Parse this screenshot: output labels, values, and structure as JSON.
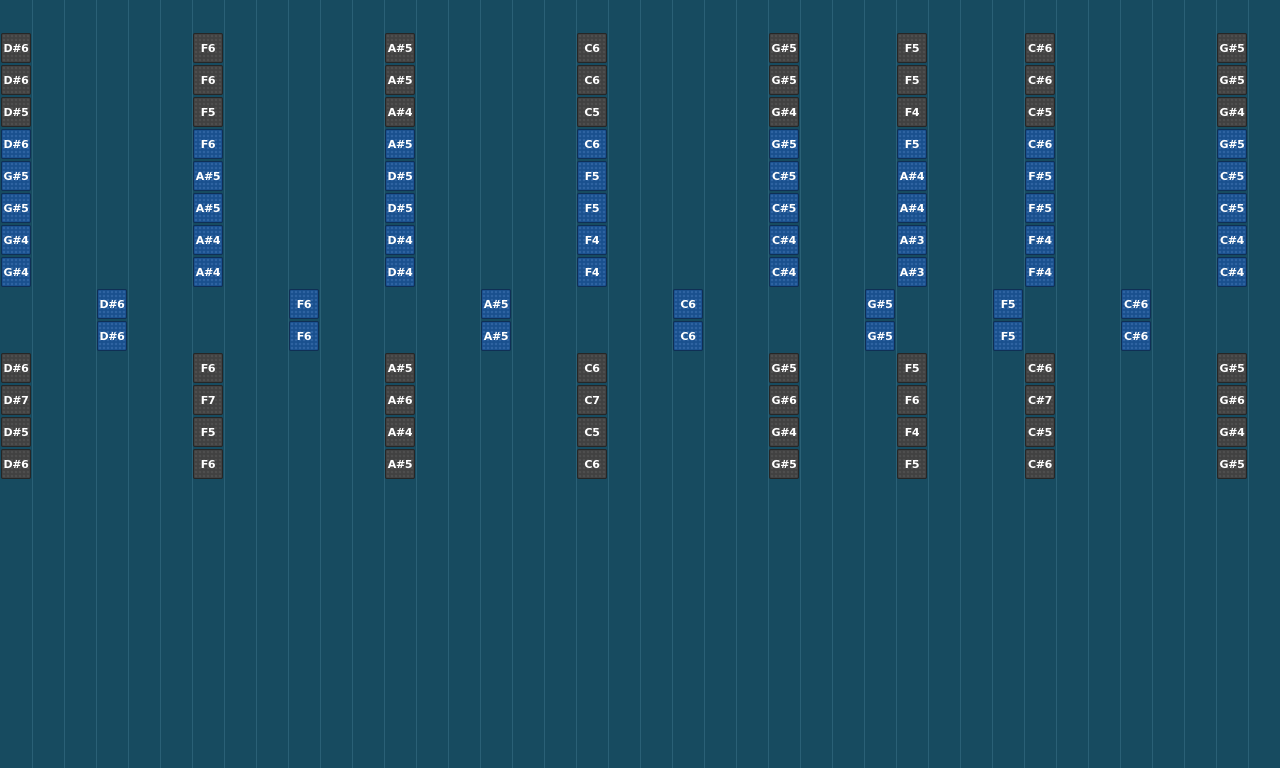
{
  "colors": {
    "background": "#174b60",
    "gridline": "#2a6076",
    "note_gray": "#414141",
    "note_blue": "#19508e"
  },
  "columns": [
    {
      "notes": [
        {
          "label": "D#6",
          "style": "gray"
        },
        {
          "label": "D#6",
          "style": "gray"
        },
        {
          "label": "D#5",
          "style": "gray"
        },
        {
          "label": "D#6",
          "style": "blue"
        },
        {
          "label": "G#5",
          "style": "blue"
        },
        {
          "label": "G#5",
          "style": "blue"
        },
        {
          "label": "G#4",
          "style": "blue"
        },
        {
          "label": "G#4",
          "style": "blue"
        },
        {
          "label": null
        },
        {
          "label": null
        },
        {
          "label": "D#6",
          "style": "gray"
        },
        {
          "label": "D#7",
          "style": "gray"
        },
        {
          "label": "D#5",
          "style": "gray"
        },
        {
          "label": "D#6",
          "style": "gray"
        }
      ]
    },
    {
      "notes": [
        {
          "label": null
        },
        {
          "label": null
        },
        {
          "label": null
        },
        {
          "label": null
        },
        {
          "label": null
        },
        {
          "label": null
        },
        {
          "label": null
        },
        {
          "label": null
        },
        {
          "label": "D#6",
          "style": "blue"
        },
        {
          "label": "D#6",
          "style": "blue"
        }
      ]
    },
    {
      "notes": [
        {
          "label": "F6",
          "style": "gray"
        },
        {
          "label": "F6",
          "style": "gray"
        },
        {
          "label": "F5",
          "style": "gray"
        },
        {
          "label": "F6",
          "style": "blue"
        },
        {
          "label": "A#5",
          "style": "blue"
        },
        {
          "label": "A#5",
          "style": "blue"
        },
        {
          "label": "A#4",
          "style": "blue"
        },
        {
          "label": "A#4",
          "style": "blue"
        },
        {
          "label": null
        },
        {
          "label": null
        },
        {
          "label": "F6",
          "style": "gray"
        },
        {
          "label": "F7",
          "style": "gray"
        },
        {
          "label": "F5",
          "style": "gray"
        },
        {
          "label": "F6",
          "style": "gray"
        }
      ]
    },
    {
      "notes": [
        {
          "label": null
        },
        {
          "label": null
        },
        {
          "label": null
        },
        {
          "label": null
        },
        {
          "label": null
        },
        {
          "label": null
        },
        {
          "label": null
        },
        {
          "label": null
        },
        {
          "label": "F6",
          "style": "blue"
        },
        {
          "label": "F6",
          "style": "blue"
        }
      ]
    },
    {
      "notes": [
        {
          "label": "A#5",
          "style": "gray"
        },
        {
          "label": "A#5",
          "style": "gray"
        },
        {
          "label": "A#4",
          "style": "gray"
        },
        {
          "label": "A#5",
          "style": "blue"
        },
        {
          "label": "D#5",
          "style": "blue"
        },
        {
          "label": "D#5",
          "style": "blue"
        },
        {
          "label": "D#4",
          "style": "blue"
        },
        {
          "label": "D#4",
          "style": "blue"
        },
        {
          "label": null
        },
        {
          "label": null
        },
        {
          "label": "A#5",
          "style": "gray"
        },
        {
          "label": "A#6",
          "style": "gray"
        },
        {
          "label": "A#4",
          "style": "gray"
        },
        {
          "label": "A#5",
          "style": "gray"
        }
      ]
    },
    {
      "notes": [
        {
          "label": null
        },
        {
          "label": null
        },
        {
          "label": null
        },
        {
          "label": null
        },
        {
          "label": null
        },
        {
          "label": null
        },
        {
          "label": null
        },
        {
          "label": null
        },
        {
          "label": "A#5",
          "style": "blue"
        },
        {
          "label": "A#5",
          "style": "blue"
        }
      ]
    },
    {
      "notes": [
        {
          "label": "C6",
          "style": "gray"
        },
        {
          "label": "C6",
          "style": "gray"
        },
        {
          "label": "C5",
          "style": "gray"
        },
        {
          "label": "C6",
          "style": "blue"
        },
        {
          "label": "F5",
          "style": "blue"
        },
        {
          "label": "F5",
          "style": "blue"
        },
        {
          "label": "F4",
          "style": "blue"
        },
        {
          "label": "F4",
          "style": "blue"
        },
        {
          "label": null
        },
        {
          "label": null
        },
        {
          "label": "C6",
          "style": "gray"
        },
        {
          "label": "C7",
          "style": "gray"
        },
        {
          "label": "C5",
          "style": "gray"
        },
        {
          "label": "C6",
          "style": "gray"
        }
      ]
    },
    {
      "notes": [
        {
          "label": null
        },
        {
          "label": null
        },
        {
          "label": null
        },
        {
          "label": null
        },
        {
          "label": null
        },
        {
          "label": null
        },
        {
          "label": null
        },
        {
          "label": null
        },
        {
          "label": "C6",
          "style": "blue"
        },
        {
          "label": "C6",
          "style": "blue"
        }
      ]
    },
    {
      "notes": [
        {
          "label": "G#5",
          "style": "gray"
        },
        {
          "label": "G#5",
          "style": "gray"
        },
        {
          "label": "G#4",
          "style": "gray"
        },
        {
          "label": "G#5",
          "style": "blue"
        },
        {
          "label": "C#5",
          "style": "blue"
        },
        {
          "label": "C#5",
          "style": "blue"
        },
        {
          "label": "C#4",
          "style": "blue"
        },
        {
          "label": "C#4",
          "style": "blue"
        },
        {
          "label": null
        },
        {
          "label": null
        },
        {
          "label": "G#5",
          "style": "gray"
        },
        {
          "label": "G#6",
          "style": "gray"
        },
        {
          "label": "G#4",
          "style": "gray"
        },
        {
          "label": "G#5",
          "style": "gray"
        }
      ]
    },
    {
      "notes": [
        {
          "label": null
        },
        {
          "label": null
        },
        {
          "label": null
        },
        {
          "label": null
        },
        {
          "label": null
        },
        {
          "label": null
        },
        {
          "label": null
        },
        {
          "label": null
        },
        {
          "label": "G#5",
          "style": "blue"
        },
        {
          "label": "G#5",
          "style": "blue"
        }
      ]
    },
    {
      "notes": [
        {
          "label": "F5",
          "style": "gray"
        },
        {
          "label": "F5",
          "style": "gray"
        },
        {
          "label": "F4",
          "style": "gray"
        },
        {
          "label": "F5",
          "style": "blue"
        },
        {
          "label": "A#4",
          "style": "blue"
        },
        {
          "label": "A#4",
          "style": "blue"
        },
        {
          "label": "A#3",
          "style": "blue"
        },
        {
          "label": "A#3",
          "style": "blue"
        },
        {
          "label": null
        },
        {
          "label": null
        },
        {
          "label": "F5",
          "style": "gray"
        },
        {
          "label": "F6",
          "style": "gray"
        },
        {
          "label": "F4",
          "style": "gray"
        },
        {
          "label": "F5",
          "style": "gray"
        }
      ]
    },
    {
      "notes": [
        {
          "label": null
        },
        {
          "label": null
        },
        {
          "label": null
        },
        {
          "label": null
        },
        {
          "label": null
        },
        {
          "label": null
        },
        {
          "label": null
        },
        {
          "label": null
        },
        {
          "label": "F5",
          "style": "blue"
        },
        {
          "label": "F5",
          "style": "blue"
        }
      ]
    },
    {
      "notes": [
        {
          "label": "C#6",
          "style": "gray"
        },
        {
          "label": "C#6",
          "style": "gray"
        },
        {
          "label": "C#5",
          "style": "gray"
        },
        {
          "label": "C#6",
          "style": "blue"
        },
        {
          "label": "F#5",
          "style": "blue"
        },
        {
          "label": "F#5",
          "style": "blue"
        },
        {
          "label": "F#4",
          "style": "blue"
        },
        {
          "label": "F#4",
          "style": "blue"
        },
        {
          "label": null
        },
        {
          "label": null
        },
        {
          "label": "C#6",
          "style": "gray"
        },
        {
          "label": "C#7",
          "style": "gray"
        },
        {
          "label": "C#5",
          "style": "gray"
        },
        {
          "label": "C#6",
          "style": "gray"
        }
      ]
    },
    {
      "notes": [
        {
          "label": null
        },
        {
          "label": null
        },
        {
          "label": null
        },
        {
          "label": null
        },
        {
          "label": null
        },
        {
          "label": null
        },
        {
          "label": null
        },
        {
          "label": null
        },
        {
          "label": "C#6",
          "style": "blue"
        },
        {
          "label": "C#6",
          "style": "blue"
        }
      ]
    },
    {
      "notes": [
        {
          "label": "G#5",
          "style": "gray"
        },
        {
          "label": "G#5",
          "style": "gray"
        },
        {
          "label": "G#4",
          "style": "gray"
        },
        {
          "label": "G#5",
          "style": "blue"
        },
        {
          "label": "C#5",
          "style": "blue"
        },
        {
          "label": "C#5",
          "style": "blue"
        },
        {
          "label": "C#4",
          "style": "blue"
        },
        {
          "label": "C#4",
          "style": "blue"
        },
        {
          "label": null
        },
        {
          "label": null
        },
        {
          "label": "G#5",
          "style": "gray"
        },
        {
          "label": "G#6",
          "style": "gray"
        },
        {
          "label": "G#4",
          "style": "gray"
        },
        {
          "label": "G#5",
          "style": "gray"
        }
      ]
    }
  ]
}
